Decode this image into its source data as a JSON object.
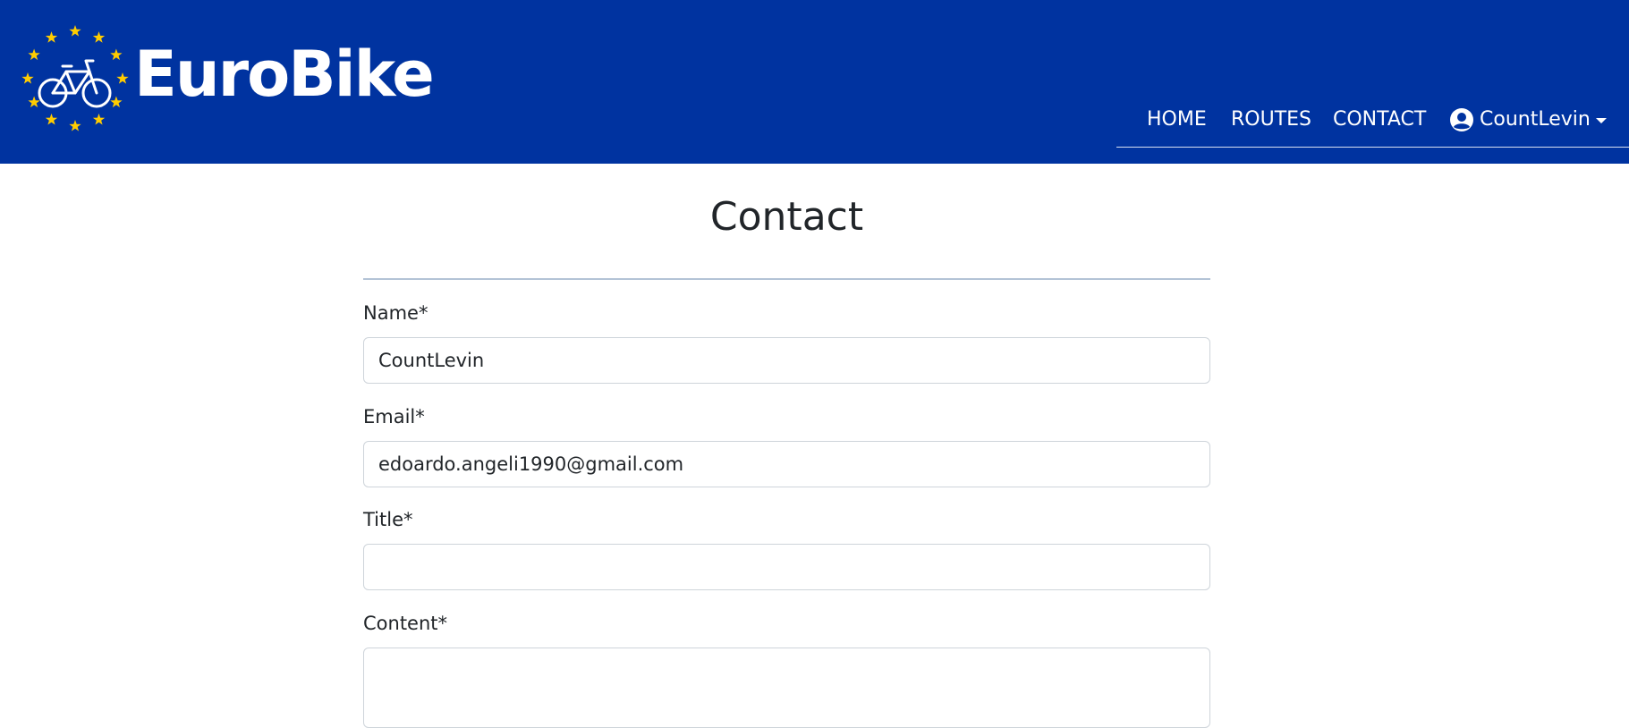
{
  "header": {
    "brand": "EuroBike",
    "logo_icon": "eu-stars-bicycle-logo",
    "background_color": "#0033a0",
    "star_color": "#ffcc00",
    "nav": {
      "home": "HOME",
      "routes": "ROUTES",
      "contact": "CONTACT",
      "user": "CountLevin"
    }
  },
  "main": {
    "title": "Contact",
    "fields": {
      "name": {
        "label": "Name*",
        "value": "CountLevin"
      },
      "email": {
        "label": "Email*",
        "value": "edoardo.angeli1990@gmail.com"
      },
      "title": {
        "label": "Title*",
        "value": ""
      },
      "content": {
        "label": "Content*",
        "value": ""
      }
    }
  }
}
